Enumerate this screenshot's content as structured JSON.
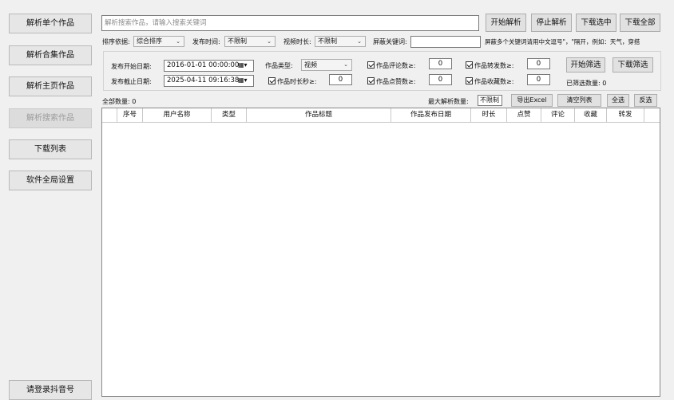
{
  "sidebar": {
    "items": [
      {
        "label": "解析单个作品"
      },
      {
        "label": "解析合集作品"
      },
      {
        "label": "解析主页作品"
      },
      {
        "label": "解析搜索作品"
      },
      {
        "label": "下载列表"
      },
      {
        "label": "软件全局设置"
      }
    ],
    "login_label": "请登录抖音号"
  },
  "search": {
    "placeholder": "解析搜索作品，请输入搜索关键词",
    "value": ""
  },
  "toolbar": {
    "start_label": "开始解析",
    "stop_label": "停止解析",
    "download_selected_label": "下载选中",
    "download_all_label": "下载全部"
  },
  "options": {
    "sort_label": "排序依据:",
    "sort_value": "综合排序",
    "time_label": "发布时间:",
    "time_value": "不限制",
    "duration_label": "视频时长:",
    "duration_value": "不限制",
    "block_label": "屏蔽关键词:",
    "block_value": "",
    "block_hint": "屏蔽多个关键词请用中文逗号\"，\"隔开，例如：天气，穿搭"
  },
  "filter": {
    "start_date_label": "发布开始日期:",
    "start_date_value": "2016-01-01 00:00:00",
    "end_date_label": "发布截止日期:",
    "end_date_value": "2025-04-11 09:16:38",
    "type_label": "作品类型:",
    "type_value": "视频",
    "duration_label": "作品时长秒≥:",
    "duration_value": "0",
    "comments_label": "作品评论数≥:",
    "comments_value": "0",
    "likes_label": "作品点赞数≥:",
    "likes_value": "0",
    "shares_label": "作品转发数≥:",
    "shares_value": "0",
    "favorites_label": "作品收藏数≥:",
    "favorites_value": "0",
    "start_filter_label": "开始筛选",
    "download_filter_label": "下载筛选",
    "filtered_count_label": "已筛选数量: 0"
  },
  "status": {
    "total_label": "全部数量: 0",
    "max_label": "最大解析数量:",
    "max_value": "不限制",
    "export_label": "导出Excel",
    "clear_label": "清空列表",
    "select_all_label": "全选",
    "invert_label": "反选"
  },
  "table": {
    "columns": [
      "",
      "序号",
      "用户名称",
      "类型",
      "作品标题",
      "作品发布日期",
      "时长",
      "点赞",
      "评论",
      "收藏",
      "转发",
      ""
    ]
  }
}
